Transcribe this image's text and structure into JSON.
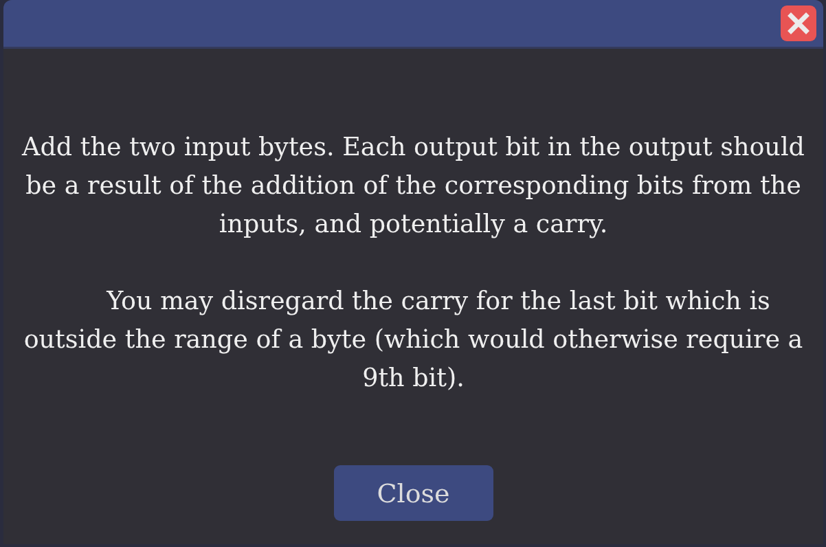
{
  "dialog": {
    "message": [
      "Add the two input bytes. Each output bit in the output should be a result of the addition of the corresponding bits from the inputs, and potentially a carry.",
      "You may disregard the carry for the last bit which is outside the range of a byte (which would otherwise require a 9th bit)."
    ],
    "buttons": [
      {
        "label": "Close"
      }
    ]
  }
}
